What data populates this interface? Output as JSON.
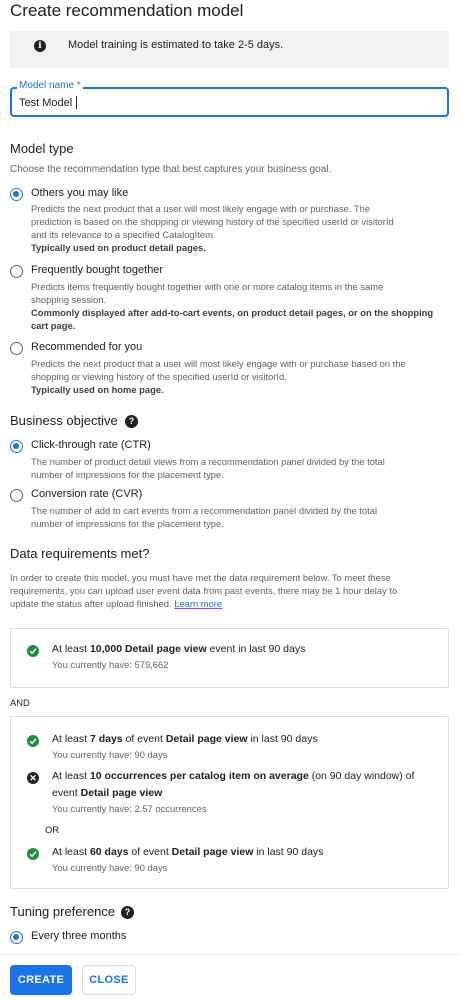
{
  "dialog": {
    "title": "Create recommendation model"
  },
  "info_banner": {
    "icon": "info-icon",
    "text": "Model training is estimated to take 2-5 days."
  },
  "model_name": {
    "label": "Model name *",
    "value": "Test Model"
  },
  "model_type": {
    "heading": "Model type",
    "subtitle": "Choose the recommendation type that best captures your business goal.",
    "options": [
      {
        "label": "Others you may like",
        "selected": true,
        "desc_1": "Predicts the next product that a user will most likely engage with or purchase. The",
        "desc_2": "prediction is based on the shopping or viewing history of the specified userId or visitorId",
        "desc_3": "and its relevance to a specified CatalogItem.",
        "emph": "Typically used on product detail pages."
      },
      {
        "label": "Frequently bought together",
        "selected": false,
        "desc_1": "Predicts items frequently bought together with one or more catalog items in the same",
        "desc_2": "shopping session.",
        "emph_1": "Commonly displayed after add-to-cart events, on product detail pages, or on the shopping",
        "emph_2": "cart page."
      },
      {
        "label": "Recommended for you",
        "selected": false,
        "desc_1": "Predicts the next product that a user will most likely engage with or purchase based on the",
        "desc_2": "shopping or viewing history of the specified userId or visitorId.",
        "emph": "Typically used on home page."
      }
    ]
  },
  "business_objective": {
    "heading": "Business objective",
    "help_icon": "help-icon",
    "options": [
      {
        "label": "Click-through rate (CTR)",
        "selected": true,
        "desc_1": "The number of product detail views from a recommendation panel divided by the total",
        "desc_2": "number of impressions for the placement type."
      },
      {
        "label": "Conversion rate (CVR)",
        "selected": false,
        "desc_1": "The number of add to cart events from a recommendation panel divided by the total",
        "desc_2": "number of impressions for the placement type."
      }
    ]
  },
  "data_requirements": {
    "heading": "Data requirements met?",
    "desc_1": "In order to create this model, you must have met the data requirement below. To meet these",
    "desc_2": "requirements, you can upload user event data from past events, there may be 1 hour delay to",
    "desc_3": "update the status after upload finished.",
    "learn_more": "Learn more",
    "req_1": {
      "status": "met",
      "pre": "At least ",
      "bold_1": "10,000 Detail page view",
      "post": " event in last 90 days",
      "have": "You currently have: 579,662"
    },
    "and_label": "AND",
    "req_2": {
      "status": "met",
      "pre": "At least ",
      "bold_1": "7 days",
      "mid": " of event ",
      "bold_2": "Detail page view",
      "post": " in last 90 days",
      "have": "You currently have: 90 days"
    },
    "req_3": {
      "status": "not-met",
      "pre": "At least ",
      "bold_1": "10 occurrences per catalog item on average",
      "post": " (on 90 day window) of",
      "line2_pre": "event ",
      "bold_2": "Detail page view",
      "have": "You currently have: 2.57 occurrences"
    },
    "or_label": "OR",
    "req_4": {
      "status": "met",
      "pre": "At least ",
      "bold_1": "60 days",
      "mid": " of event ",
      "bold_2": "Detail page view",
      "post": " in last 90 days",
      "have": "You currently have: 90 days"
    }
  },
  "tuning": {
    "heading": "Tuning preference",
    "help_icon": "help-icon",
    "option_label": "Every three months",
    "selected": true
  },
  "actions": {
    "create_label": "CREATE",
    "close_label": "CLOSE"
  },
  "colors": {
    "accent": "#1a73e8",
    "success": "#1e8e3e",
    "muted_text": "#5f6368",
    "banner_bg": "#f1f3f4"
  }
}
